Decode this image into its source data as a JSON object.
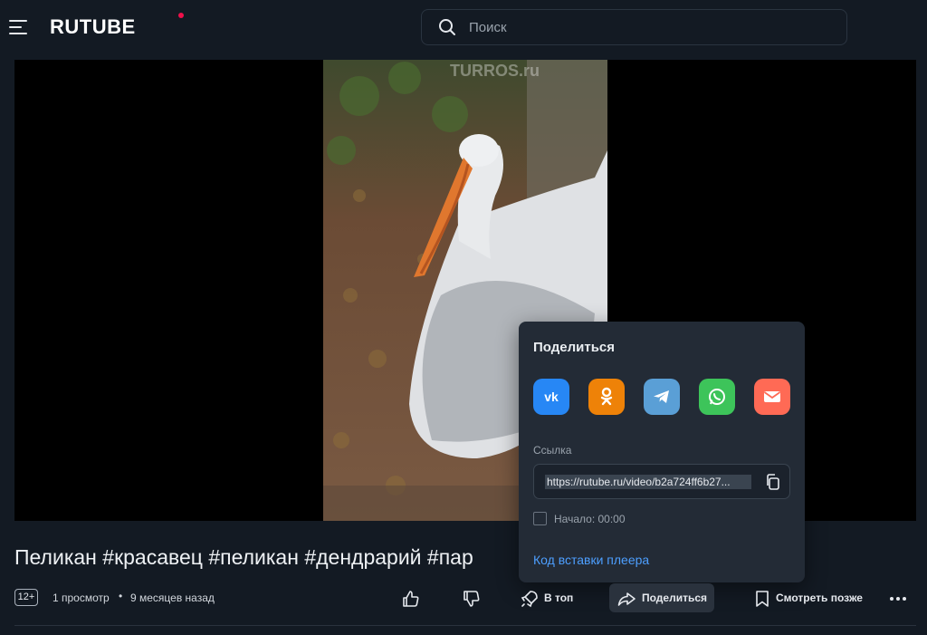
{
  "header": {
    "logo_text": "RUTUBE",
    "search_placeholder": "Поиск"
  },
  "player": {
    "watermark": "TURROS.ru"
  },
  "share_popup": {
    "title": "Поделиться",
    "socials": [
      {
        "name": "vk",
        "color": "#2787f5"
      },
      {
        "name": "odnoklassniki",
        "color": "#ee8208"
      },
      {
        "name": "telegram",
        "color": "#5a9fd6"
      },
      {
        "name": "whatsapp",
        "color": "#3dc45a"
      },
      {
        "name": "email",
        "color": "#ff6a55"
      }
    ],
    "link_label": "Ссылка",
    "link_value": "https://rutube.ru/video/b2a724ff6b27...",
    "start_label": "Начало: 00:00",
    "embed_label": "Код вставки плеера"
  },
  "video": {
    "title": "Пеликан #красавец #пеликан #дендрарий #пар",
    "age_rating": "12+",
    "views": "1 просмотр",
    "separator": "•",
    "published": "9 месяцев назад"
  },
  "actions": {
    "top_label": "В топ",
    "share_label": "Поделиться",
    "watch_later_label": "Смотреть позже"
  },
  "colors": {
    "background": "#131a23",
    "accent_link": "#4d9fff",
    "logo_dot": "#f0104a"
  }
}
